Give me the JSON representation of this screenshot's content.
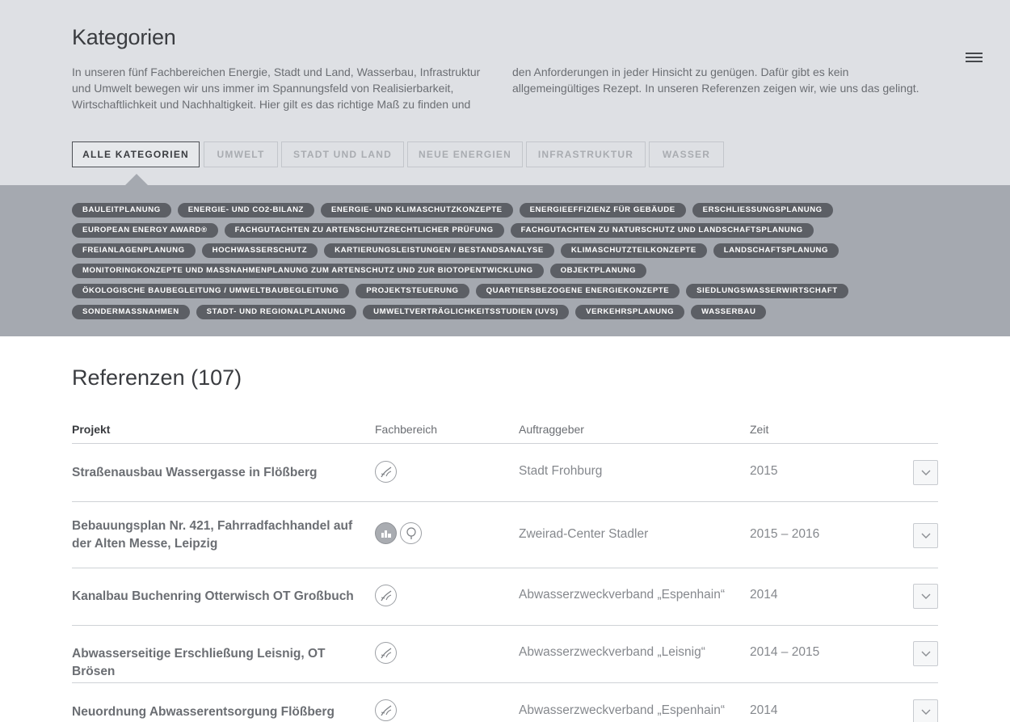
{
  "header": {
    "title": "Kategorien",
    "intro_col1": "In unseren fünf Fachbereichen Energie, Stadt und Land, Wasserbau, Infrastruktur und Umwelt bewegen wir uns immer im Spannungsfeld von Realisierbarkeit, Wirtschaftlichkeit und Nachhaltigkeit. Hier gilt es das richtige Maß zu finden und",
    "intro_col2": "den Anforderungen in jeder Hinsicht zu genügen. Dafür gibt es kein allgemeingültiges Rezept. In unseren Referenzen zeigen wir, wie uns das gelingt.",
    "menu_icon": "hamburger-menu-icon"
  },
  "tabs": [
    {
      "label": "ALLE KATEGORIEN",
      "active": true
    },
    {
      "label": "UMWELT",
      "active": false
    },
    {
      "label": "STADT UND LAND",
      "active": false
    },
    {
      "label": "NEUE ENERGIEN",
      "active": false
    },
    {
      "label": "INFRASTRUKTUR",
      "active": false
    },
    {
      "label": "WASSER",
      "active": false
    }
  ],
  "tag_rows": [
    [
      "BAULEITPLANUNG",
      "ENERGIE- UND CO2-BILANZ",
      "ENERGIE- UND KLIMASCHUTZKONZEPTE",
      "ENERGIEEFFIZIENZ FÜR GEBÄUDE",
      "ERSCHLIESSUNGSPLANUNG"
    ],
    [
      "EUROPEAN ENERGY AWARD®",
      "FACHGUTACHTEN ZU ARTENSCHUTZRECHTLICHER PRÜFUNG",
      "FACHGUTACHTEN ZU NATURSCHUTZ UND LANDSCHAFTSPLANUNG"
    ],
    [
      "FREIANLAGENPLANUNG",
      "HOCHWASSERSCHUTZ",
      "KARTIERUNGSLEISTUNGEN / BESTANDSANALYSE",
      "KLIMASCHUTZTEILKONZEPTE",
      "LANDSCHAFTSPLANUNG"
    ],
    [
      "MONITORINGKONZEPTE UND MASSNAHMENPLANUNG ZUM ARTENSCHUTZ UND ZUR BIOTOPENTWICKLUNG",
      "OBJEKTPLANUNG"
    ],
    [
      "ÖKOLOGISCHE BAUBEGLEITUNG / UMWELTBAUBEGLEITUNG",
      "PROJEKTSTEUERUNG",
      "QUARTIERSBEZOGENE ENERGIEKONZEPTE",
      "SIEDLUNGSWASSERWIRTSCHAFT"
    ],
    [
      "SONDERMASSNAHMEN",
      "STADT- UND REGIONALPLANUNG",
      "UMWELTVERTRÄGLICHKEITSSTUDIEN (UVS)",
      "VERKEHRSPLANUNG",
      "WASSERBAU"
    ]
  ],
  "references": {
    "title": "Referenzen (107)",
    "columns": {
      "projekt": "Projekt",
      "fachbereich": "Fachbereich",
      "auftraggeber": "Auftraggeber",
      "zeit": "Zeit"
    },
    "rows": [
      {
        "projekt": "Straßenausbau Wassergasse in Flößberg",
        "fachbereich": [
          "wasser-icon"
        ],
        "auftraggeber": "Stadt Frohburg",
        "zeit": "2015"
      },
      {
        "projekt": "Bebauungsplan Nr. 421, Fahrradfachhandel auf der Alten Messe, Leipzig",
        "fachbereich": [
          "stadt-und-land-icon",
          "umwelt-tree-icon"
        ],
        "auftraggeber": "Zweirad-Center Stadler",
        "zeit": "2015 – 2016"
      },
      {
        "projekt": "Kanalbau Buchenring Otterwisch OT Großbuch",
        "fachbereich": [
          "wasser-icon"
        ],
        "auftraggeber": "Abwasserzweckverband „Espenhain“",
        "zeit": "2014"
      },
      {
        "projekt": "Abwasserseitige Erschließung Leisnig, OT Brösen",
        "fachbereich": [
          "wasser-icon"
        ],
        "auftraggeber": "Abwasserzweckverband „Leisnig“",
        "zeit": "2014 – 2015"
      },
      {
        "projekt": "Neuordnung Abwasserentsorgung Flößberg",
        "fachbereich": [
          "wasser-icon"
        ],
        "auftraggeber": "Abwasserzweckverband „Espenhain“",
        "zeit": "2014"
      }
    ]
  },
  "colors": {
    "header_bg": "#dee0e4",
    "tag_band_bg": "#a5a9b0",
    "tag_bg": "#5c5f65",
    "text_dark": "#3a3c40"
  }
}
